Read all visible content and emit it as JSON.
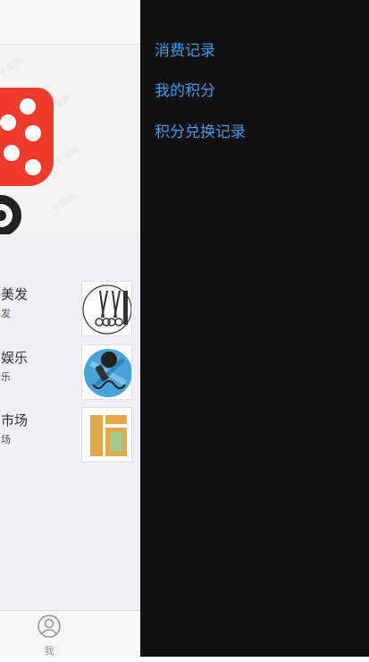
{
  "drawer": {
    "items": [
      {
        "label": "消费记录"
      },
      {
        "label": "我的积分"
      },
      {
        "label": "积分兑换记录"
      }
    ]
  },
  "main": {
    "banner": {
      "watermark": "千库网"
    },
    "list": [
      {
        "title": "美发",
        "subtitle": "发",
        "thumb_icon": "scissors-icon"
      },
      {
        "title": "娱乐",
        "subtitle": "乐",
        "thumb_icon": "microphone-icon"
      },
      {
        "title": "市场",
        "subtitle": "场",
        "thumb_icon": "fortune-character-icon"
      }
    ],
    "tabbar": {
      "me_label": "我"
    }
  },
  "colors": {
    "drawer_bg": "#111111",
    "drawer_link": "#3a9bef",
    "cart_red": "#ef3b2c",
    "list_bg": "#efeff4"
  }
}
